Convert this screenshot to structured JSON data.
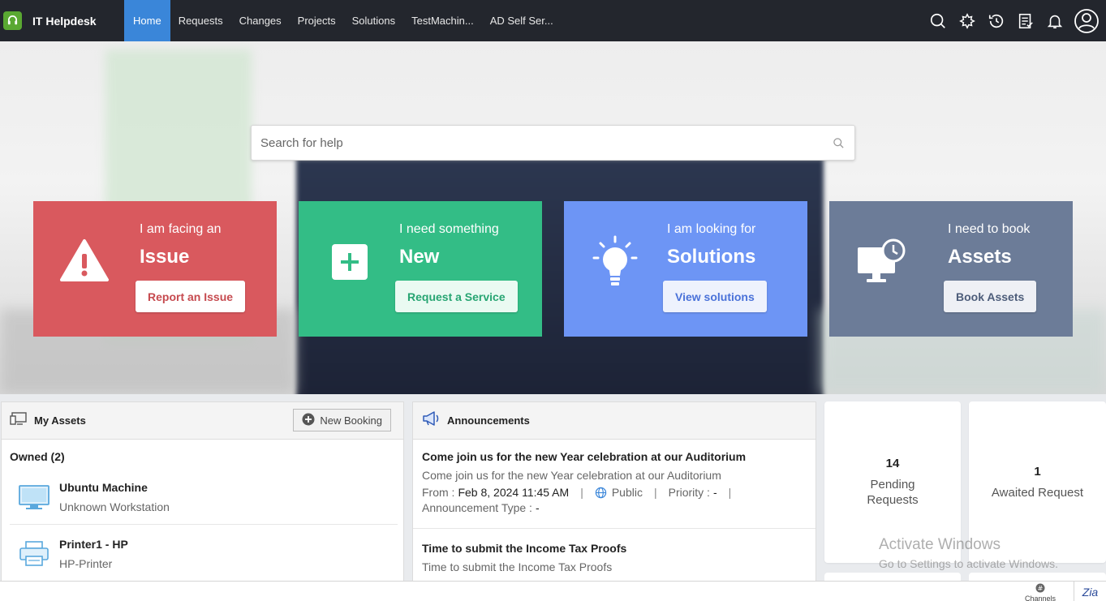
{
  "app": {
    "title": "IT Helpdesk"
  },
  "nav": {
    "items": [
      {
        "label": "Home",
        "active": true
      },
      {
        "label": "Requests"
      },
      {
        "label": "Changes"
      },
      {
        "label": "Projects"
      },
      {
        "label": "Solutions"
      },
      {
        "label": "TestMachin..."
      },
      {
        "label": "AD Self Ser..."
      }
    ],
    "icons": [
      "search-icon",
      "ticket-icon",
      "history-icon",
      "checklist-icon",
      "bell-icon",
      "user-avatar-icon"
    ]
  },
  "search": {
    "placeholder": "Search for help"
  },
  "cards": {
    "issue": {
      "sub": "I am facing an",
      "big": "Issue",
      "button": "Report an Issue",
      "color": "#d9595e"
    },
    "new": {
      "sub": "I need something",
      "big": "New",
      "button": "Request a Service",
      "color": "#33bd86"
    },
    "solutions": {
      "sub": "I am looking for",
      "big": "Solutions",
      "button": "View solutions",
      "color": "#6d95f5"
    },
    "assets": {
      "sub": "I need to book",
      "big": "Assets",
      "button": "Book Assets",
      "color": "#6c7c98"
    }
  },
  "my_assets": {
    "title": "My Assets",
    "new_booking": "New Booking",
    "owned_label": "Owned (2)",
    "items": [
      {
        "name": "Ubuntu Machine",
        "type": "Unknown Workstation"
      },
      {
        "name": "Printer1 - HP",
        "type": "HP-Printer"
      }
    ]
  },
  "announcements": {
    "title": "Announcements",
    "items": [
      {
        "title": "Come join us for the new Year celebration at our Auditorium",
        "desc": "Come join us for the new Year celebration at our Auditorium",
        "from_label": "From :",
        "from_value": "Feb 8, 2024 11:45 AM",
        "visibility": "Public",
        "priority_label": "Priority :",
        "priority_value": "-",
        "type_label": "Announcement Type :",
        "type_value": "-"
      },
      {
        "title": "Time to submit the Income Tax Proofs",
        "desc": "Time to submit the Income Tax Proofs"
      }
    ]
  },
  "stats": {
    "pending": {
      "count": "14",
      "label": "Pending Requests"
    },
    "awaited": {
      "count": "1",
      "label": "Awaited Request"
    }
  },
  "watermark": {
    "line1": "Activate Windows",
    "line2": "Go to Settings to activate Windows."
  },
  "footer": {
    "channels": "Channels",
    "zia": "Zia"
  }
}
